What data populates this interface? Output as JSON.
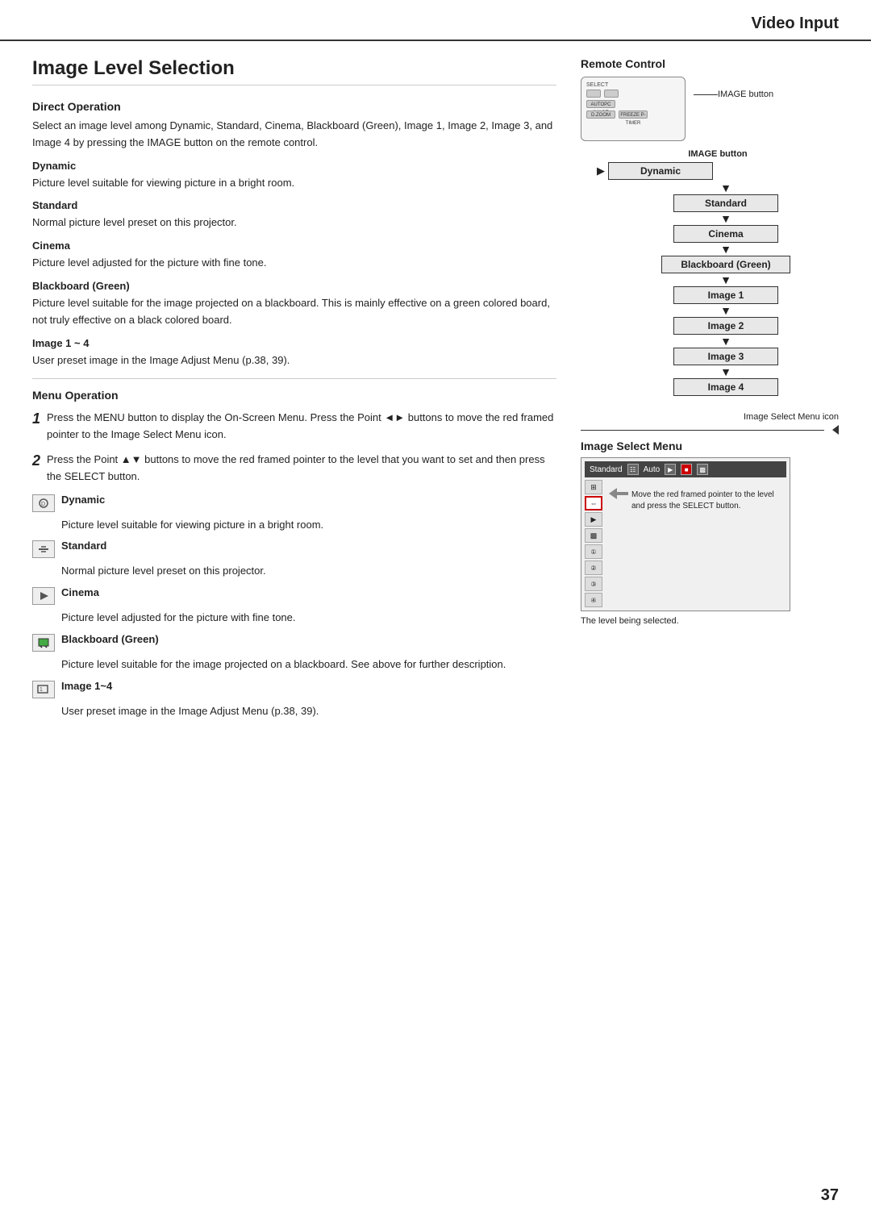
{
  "header": {
    "title": "Video Input"
  },
  "page": {
    "number": "37",
    "main_title": "Image Level Selection"
  },
  "left": {
    "direct_operation_heading": "Direct Operation",
    "direct_operation_text": "Select an image level among Dynamic, Standard, Cinema, Blackboard (Green), Image 1, Image 2, Image 3, and Image 4 by pressing the IMAGE button on the remote control.",
    "dynamic_heading": "Dynamic",
    "dynamic_text": "Picture level suitable for viewing picture in a bright room.",
    "standard_heading": "Standard",
    "standard_text": "Normal picture level preset on this projector.",
    "cinema_heading": "Cinema",
    "cinema_text": "Picture level adjusted for the picture with fine tone.",
    "blackboard_heading": "Blackboard (Green)",
    "blackboard_text": "Picture level suitable for the image projected on a blackboard. This is mainly effective on a green colored board, not truly effective on a black colored board.",
    "image14_heading": "Image 1 ~ 4",
    "image14_text": "User preset image in the Image Adjust Menu (p.38, 39).",
    "menu_operation_heading": "Menu Operation",
    "step1_text": "Press the MENU button to display the On-Screen Menu. Press the Point ◄► buttons to move the red framed pointer to the Image Select Menu icon.",
    "step2_text": "Press the Point ▲▼ buttons to move the red framed pointer to the level that you want to set and then press the SELECT button.",
    "icon_dynamic_label": "Dynamic",
    "icon_dynamic_text": "Picture level suitable for viewing picture in a bright room.",
    "icon_standard_label": "Standard",
    "icon_standard_text": "Normal picture level preset on this projector.",
    "icon_cinema_label": "Cinema",
    "icon_cinema_text": "Picture level adjusted for the picture with fine tone.",
    "icon_blackboard_label": "Blackboard (Green)",
    "icon_blackboard_text": "Picture level suitable for the image projected on a blackboard. See above for further description.",
    "icon_image14_label": "Image 1~4",
    "icon_image14_text": "User preset image in the Image Adjust Menu (p.38, 39)."
  },
  "right": {
    "remote_control_heading": "Remote Control",
    "image_button_label": "IMAGE button",
    "flow": {
      "title": "IMAGE button",
      "items": [
        "Dynamic",
        "Standard",
        "Cinema",
        "Blackboard (Green)",
        "Image 1",
        "Image 2",
        "Image 3",
        "Image 4"
      ]
    },
    "menu_section": {
      "icon_note": "Image Select Menu icon",
      "heading": "Image Select Menu",
      "topbar_label": "Standard",
      "topbar_btn": "Auto",
      "callout_text": "Move the red framed pointer to the level and press the SELECT button.",
      "bottom_note": "The level being selected."
    }
  }
}
